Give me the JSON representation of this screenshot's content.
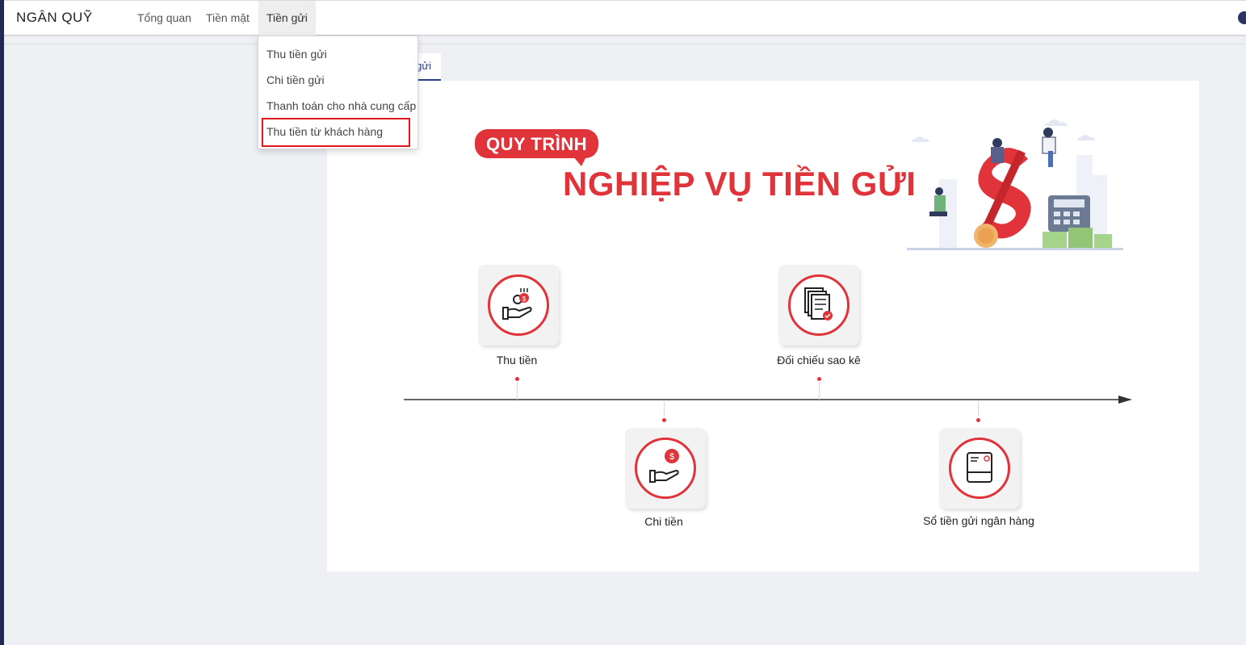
{
  "navbar": {
    "brand": "NGÂN QUỸ",
    "items": [
      {
        "label": "Tổng quan"
      },
      {
        "label": "Tiền mặt"
      },
      {
        "label": "Tiền gửi"
      }
    ]
  },
  "dropdown": {
    "items": [
      {
        "label": "Thu tiền gửi"
      },
      {
        "label": "Chi tiền gửi"
      },
      {
        "label": "Thanh toán cho nhà cung cấp"
      },
      {
        "label": "Thu tiền từ khách hàng"
      }
    ],
    "highlighted_index": 3
  },
  "tab": {
    "label": "gửi"
  },
  "banner": {
    "badge": "QUY TRÌNH",
    "title": "NGHIỆP VỤ TIỀN GỬI"
  },
  "steps": [
    {
      "label": "Thu tiền",
      "icon": "hand-coins-icon"
    },
    {
      "label": "Chi tiền",
      "icon": "hand-dollar-icon"
    },
    {
      "label": "Đối chiếu sao kê",
      "icon": "documents-check-icon"
    },
    {
      "label": "Sổ tiền gửi ngân hàng",
      "icon": "bank-book-icon"
    }
  ],
  "colors": {
    "accent": "#e0333a",
    "navy": "#2b3c8f",
    "sidebar_edge": "#232a52",
    "highlight": "#e0161d"
  }
}
